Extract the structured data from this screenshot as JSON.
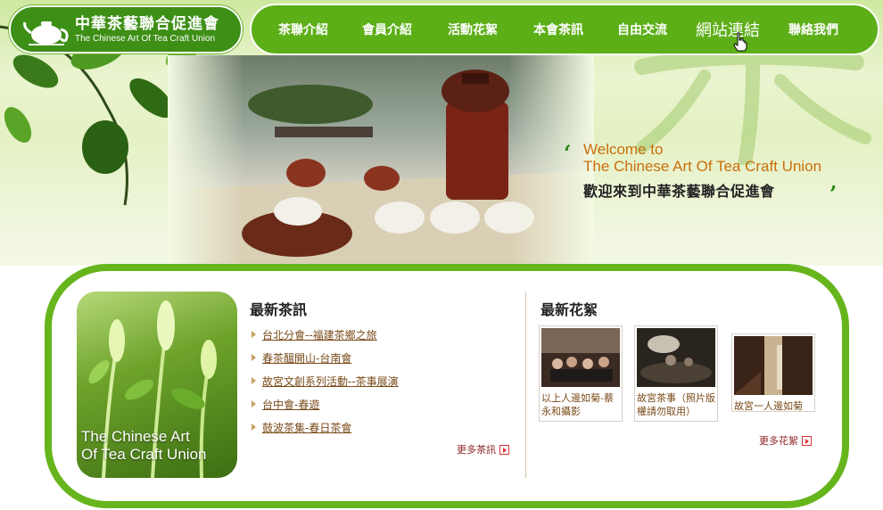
{
  "logo": {
    "title_zh": "中華茶藝聯合促進會",
    "title_en": "The Chinese Art Of Tea Craft Union"
  },
  "nav": {
    "items": [
      {
        "label": "茶聯介紹"
      },
      {
        "label": "會員介紹"
      },
      {
        "label": "活動花絮"
      },
      {
        "label": "本會茶訊"
      },
      {
        "label": "自由交流"
      },
      {
        "label": "網站連結",
        "active": true
      },
      {
        "label": "聯絡我們"
      }
    ]
  },
  "welcome": {
    "line1": "Welcome to",
    "line2": "The Chinese Art Of Tea Craft Union",
    "line_zh": "歡迎來到中華茶藝聯合促進會"
  },
  "news": {
    "title": "最新茶訊",
    "items": [
      {
        "label": "台北分會--福建茶鄉之旅"
      },
      {
        "label": "春茶醞開山-台南會"
      },
      {
        "label": "故宮文創系列活動--茶事展演"
      },
      {
        "label": "台中會-春遊"
      },
      {
        "label": "鼓波茶集-春日茶會"
      }
    ],
    "more": "更多茶訊"
  },
  "photos": {
    "title": "最新花絮",
    "items": [
      {
        "caption": "以上人邊如菊-蔡永和攝影"
      },
      {
        "caption": "故宮茶事（照片版權請勿取用）"
      },
      {
        "caption": "故宮一人邊如菊"
      }
    ],
    "more": "更多花絮"
  },
  "side_photo": {
    "caption_l1": "The Chinese Art",
    "caption_l2": "Of Tea Craft Union"
  },
  "colors": {
    "nav_green": "#5daf18",
    "logo_green": "#3d8f16",
    "panel_border": "#66b51c",
    "welcome_orange": "#c96f0c",
    "link_brown": "#7a4b1a",
    "more_red": "#8a1f1f"
  }
}
